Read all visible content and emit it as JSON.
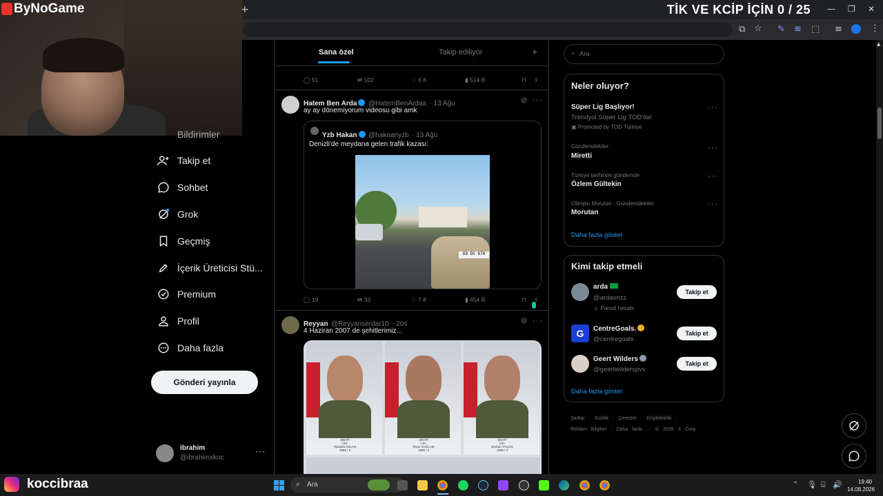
{
  "overlay": {
    "brand": "ByNoGame",
    "title": "TİK VE KCİP İÇİN 0 / 25",
    "instagram_handle": "koccibraa"
  },
  "browser": {
    "new_tab": "+"
  },
  "nav": {
    "items": [
      {
        "label": "Bildirimler"
      },
      {
        "label": "Takip et"
      },
      {
        "label": "Sohbet"
      },
      {
        "label": "Grok"
      },
      {
        "label": "Geçmiş"
      },
      {
        "label": "İçerik Üreticisi Stü..."
      },
      {
        "label": "Premium"
      },
      {
        "label": "Profil"
      },
      {
        "label": "Daha fazla"
      }
    ],
    "post_button": "Gönderi yayınla",
    "account": {
      "name": "ibrahim",
      "handle": "@ibrahimxkoc"
    }
  },
  "tabs": {
    "for_you": "Sana özel",
    "following": "Takip ediliyor",
    "add": "+"
  },
  "first_tweet_stats": {
    "replies": "51",
    "retweets": "102",
    "likes": "6 8",
    "views": "514 B"
  },
  "tweets": [
    {
      "name": "Hatem Ben Arda",
      "handle": "@HatemBenArdaa",
      "time": "· 13 Ağu",
      "text": "ay ay dönemiyorum videosu gibi amk",
      "quote": {
        "name": "Yzb Hakan",
        "handle": "@hakaanyzb",
        "time": "· 13 Ağu",
        "text": "Denizli'de meydana gelen trafik kazası:",
        "plate": "68 DS 878"
      },
      "stats": {
        "replies": "19",
        "retweets": "33",
        "likes": "7 8",
        "views": "454 B"
      }
    },
    {
      "name": "Reyyan",
      "handle": "@Reyyanserdar10",
      "time": "· 20s",
      "text": "4 Haziran 2007 de şehitlerimiz...",
      "photos": [
        {
          "caption": "ŞEHİT",
          "sub": "J.Er.",
          "person": "Mustafa ASLAN",
          "year": "1986 / 3"
        },
        {
          "caption": "ŞEHİT",
          "sub": "J.Er.",
          "person": "İhsan SAĞLAM",
          "year": "1986 / 2"
        },
        {
          "caption": "ŞEHİT",
          "sub": "J.Er.",
          "person": "Burhan YALÇIN",
          "year": "1986 / 3"
        }
      ]
    }
  ],
  "right": {
    "search_placeholder": "Ara",
    "trends_title": "Neler oluyor?",
    "trends": [
      {
        "context": "",
        "name": "Süper Lig Başlıyor!",
        "sub": "Trendyol Süper Lig TOD'da!",
        "promo": "Promoted by TOD Türkiye"
      },
      {
        "context": "Gündemdekiler",
        "name": "Miretti"
      },
      {
        "context": "Türkiye tarihinde gündemde",
        "name": "Özlem Gültekin"
      },
      {
        "context": "Olimpiu Morutan · Gündemdekiler",
        "name": "Morutan"
      }
    ],
    "trends_more": "Daha fazla göster",
    "who_title": "Kimi takip etmeli",
    "who": [
      {
        "name": "arda",
        "handle": "@ardasnzz",
        "note": "Parodi hesabı",
        "button": "Takip et"
      },
      {
        "name": "CentreGoals.",
        "handle": "@centregoals",
        "button": "Takip et"
      },
      {
        "name": "Geert Wilders",
        "handle": "@geertwilderspvv",
        "button": "Takip et"
      }
    ],
    "who_more": "Daha fazla göster",
    "footer": [
      "Şartlar",
      "·",
      "Gizlilik",
      "·",
      "Çerezler",
      "·",
      "Erişilebilirlik",
      "·",
      "Reklam Bilgileri",
      "·",
      "Daha fazla ···",
      "© 2026 X Corp."
    ]
  },
  "taskbar": {
    "search": "Ara",
    "time": "19:40",
    "date": "14.08.2026"
  },
  "colors": {
    "accent": "#1d9bf0",
    "bg": "#000000",
    "brand_red": "#e8322b"
  }
}
